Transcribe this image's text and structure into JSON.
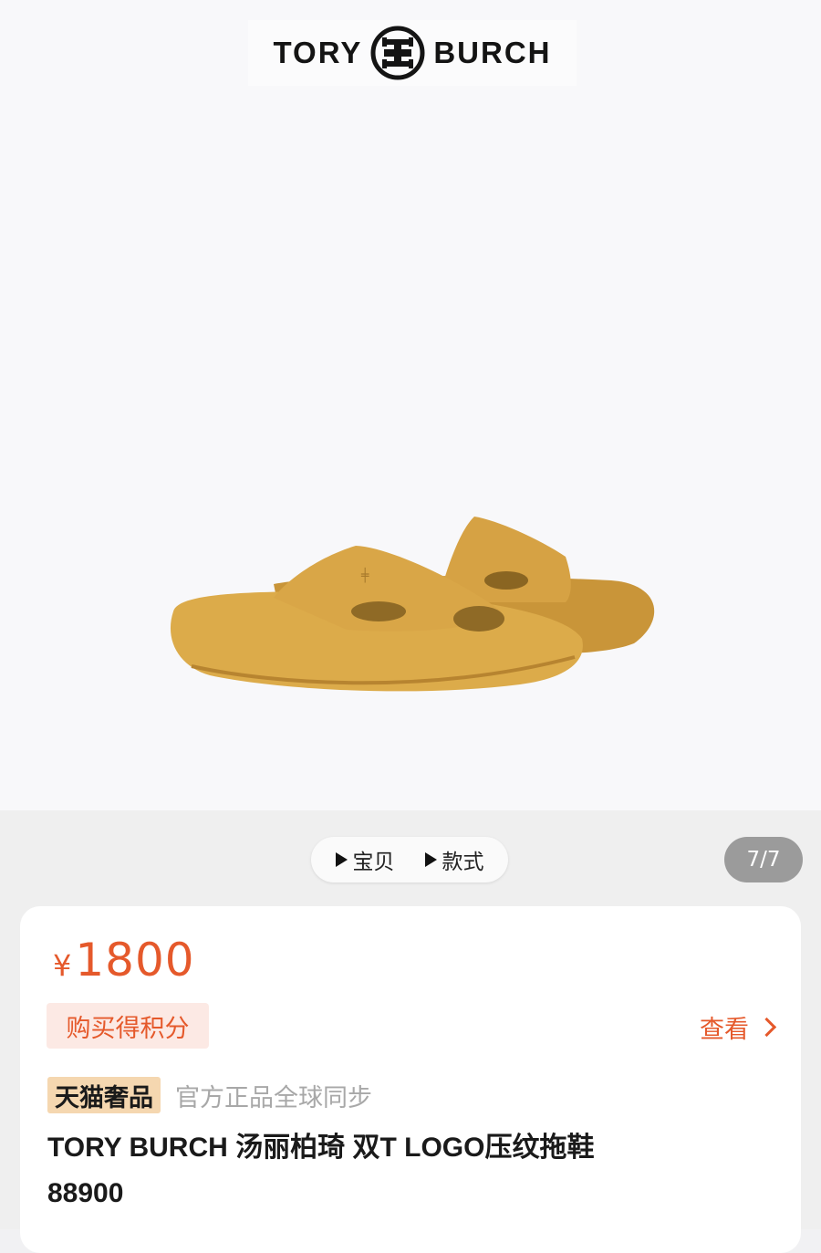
{
  "brand": {
    "left_word": "TORY",
    "right_word": "BURCH",
    "emblem": "double-t-logo"
  },
  "gallery": {
    "image": "yellow-slide-sandals",
    "counter": "7/7"
  },
  "switcher": {
    "items": [
      {
        "label": "宝贝",
        "icon": "play-triangle-icon"
      },
      {
        "label": "款式",
        "icon": "play-triangle-icon"
      }
    ]
  },
  "product": {
    "currency": "¥",
    "price": "1800",
    "points_label": "购买得积分",
    "view_label": "查看",
    "tag": "天猫奢品",
    "tag_note": "官方正品全球同步",
    "title_line1": "TORY BURCH 汤丽柏琦 双T LOGO压纹拖鞋",
    "title_line2": "88900"
  },
  "colors": {
    "accent": "#e5592b",
    "tag_bg": "#f5d7b0",
    "sandal": "#d9a53f"
  }
}
